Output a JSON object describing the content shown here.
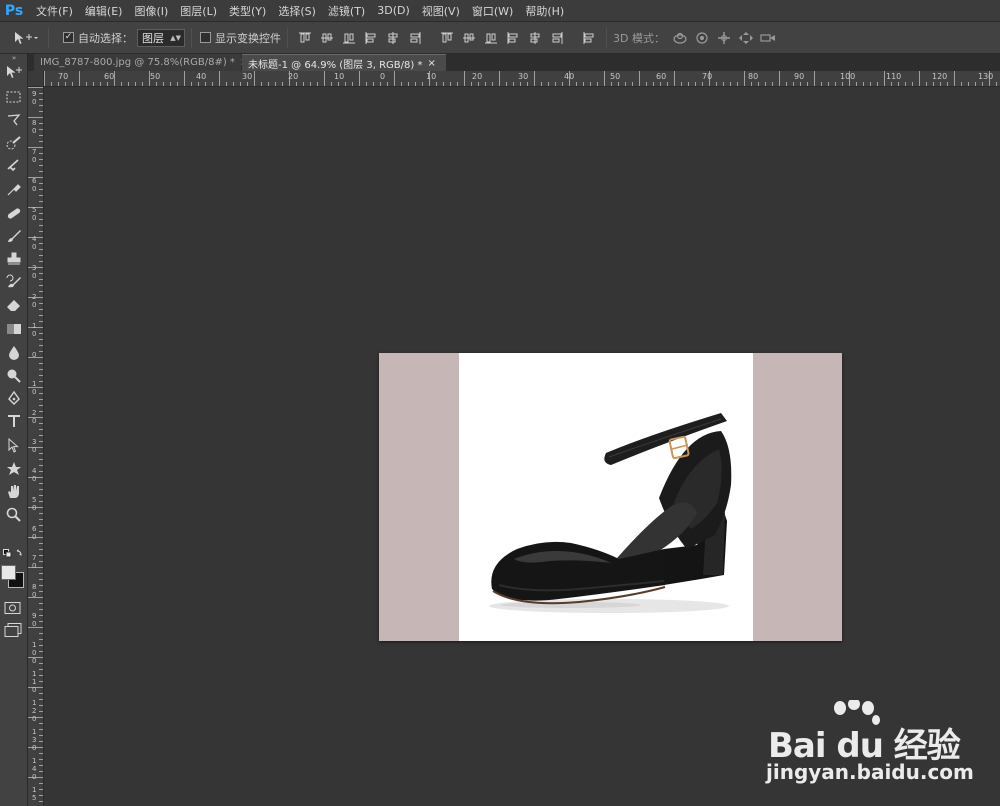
{
  "app": {
    "logo": "Ps"
  },
  "menu": {
    "items": [
      "文件(F)",
      "编辑(E)",
      "图像(I)",
      "图层(L)",
      "类型(Y)",
      "选择(S)",
      "滤镜(T)",
      "3D(D)",
      "视图(V)",
      "窗口(W)",
      "帮助(H)"
    ]
  },
  "options": {
    "auto_select_label": "自动选择：",
    "auto_select_checked": true,
    "auto_select_target": "图层",
    "show_transform_label": "显示变换控件",
    "show_transform_checked": false,
    "mode_3d_label": "3D 模式："
  },
  "tools": [
    "move-tool",
    "marquee-tool",
    "lasso-tool",
    "quick-selection-tool",
    "crop-tool",
    "eyedropper-tool",
    "spot-healing-tool",
    "brush-tool",
    "clone-stamp-tool",
    "history-brush-tool",
    "eraser-tool",
    "gradient-tool",
    "blur-tool",
    "dodge-tool",
    "pen-tool",
    "type-tool",
    "path-selection-tool",
    "shape-tool",
    "hand-tool",
    "zoom-tool"
  ],
  "colors": {
    "foreground": "#e8e8e8",
    "background": "#111111",
    "canvas_bg": "#c6b6b6",
    "workspace": "#353535"
  },
  "tabs": [
    {
      "label": "IMG_8787-800.jpg @ 75.8%(RGB/8#) *",
      "active": false
    },
    {
      "label": "未标题-1 @ 64.9% (图层 3, RGB/8) *",
      "active": true
    }
  ],
  "close_glyph": "×",
  "rulers": {
    "horizontal": [
      "70",
      "60",
      "50",
      "40",
      "30",
      "20",
      "10",
      "0",
      "10",
      "20",
      "30",
      "40",
      "50",
      "60",
      "70",
      "80",
      "90",
      "100",
      "110",
      "120",
      "130"
    ],
    "vertical": [
      "9 0",
      "8 0",
      "7 0",
      "6 0",
      "5 0",
      "4 0",
      "3 0",
      "2 0",
      "1 0",
      "0",
      "1 0",
      "2 0",
      "3 0",
      "4 0",
      "5 0",
      "6 0",
      "7 0",
      "8 0",
      "9 0",
      "1 0 0",
      "1 1 0",
      "1 2 0",
      "1 3 0",
      "1 4 0",
      "1 5"
    ]
  },
  "watermark": {
    "brand": "Bai du 经验",
    "url": "jingyan.baidu.com"
  }
}
